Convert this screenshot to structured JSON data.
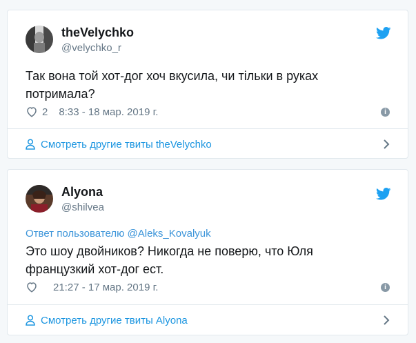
{
  "tweets": [
    {
      "author_name": "theVelychko",
      "handle": "@velychko_r",
      "text": "Так вона той хот-дог хоч вкусила, чи тільки в руках потримала?",
      "likes": "2",
      "timestamp": "8:33 - 18 мар. 2019 г.",
      "more_label": "Смотреть другие твиты theVelychko"
    },
    {
      "author_name": "Alyona",
      "handle": "@shilvea",
      "reply_prefix": "Ответ пользователю",
      "reply_to": "@Aleks_Kovalyuk",
      "text": "Это шоу двойников? Никогда не поверю, что Юля французкий хот-дог ест.",
      "likes": "",
      "timestamp": "21:27 - 17 мар. 2019 г.",
      "more_label": "Смотреть другие твиты Alyona"
    }
  ],
  "colors": {
    "accent": "#1da1f2",
    "link": "#1b95e0",
    "muted": "#657786",
    "border": "#e1e8ed"
  },
  "icons": [
    "twitter-bird-icon",
    "heart-icon",
    "info-icon",
    "person-icon",
    "chevron-right-icon"
  ]
}
